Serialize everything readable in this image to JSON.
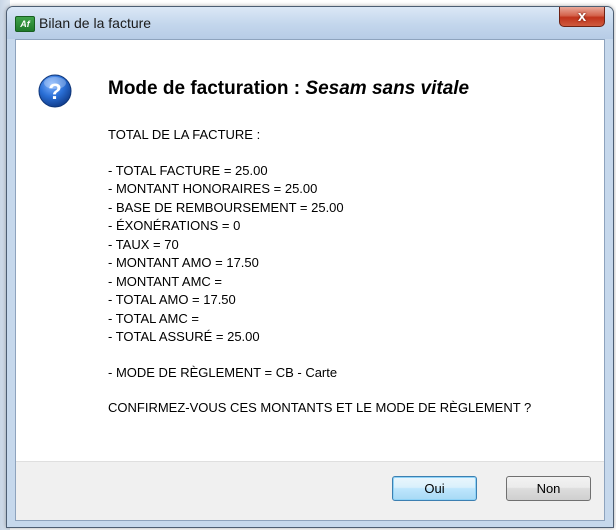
{
  "window": {
    "app_icon_text": "Af",
    "title": "Bilan de la facture",
    "close_glyph": "x"
  },
  "dialog": {
    "icon": "question-icon",
    "heading_prefix": "Mode de facturation : ",
    "heading_mode": "Sesam sans vitale",
    "total_header": "TOTAL DE LA FACTURE :",
    "lines": [
      "- TOTAL FACTURE = 25.00",
      "- MONTANT HONORAIRES = 25.00",
      "- BASE DE REMBOURSEMENT = 25.00",
      "- ÉXONÉRATIONS = 0",
      "- TAUX = 70",
      "- MONTANT AMO = 17.50",
      "- MONTANT AMC =",
      "- TOTAL AMO = 17.50",
      "- TOTAL AMC =",
      "- TOTAL ASSURÉ = 25.00"
    ],
    "payment_mode": "- MODE DE RÈGLEMENT = CB - Carte",
    "confirm_question": "CONFIRMEZ-VOUS CES MONTANTS ET LE MODE DE RÈGLEMENT ?"
  },
  "buttons": {
    "yes": "Oui",
    "no": "Non"
  },
  "colors": {
    "icon_blue": "#1f5fbf",
    "default_button_border": "#3c7fb1",
    "close_red": "#c0331b"
  }
}
